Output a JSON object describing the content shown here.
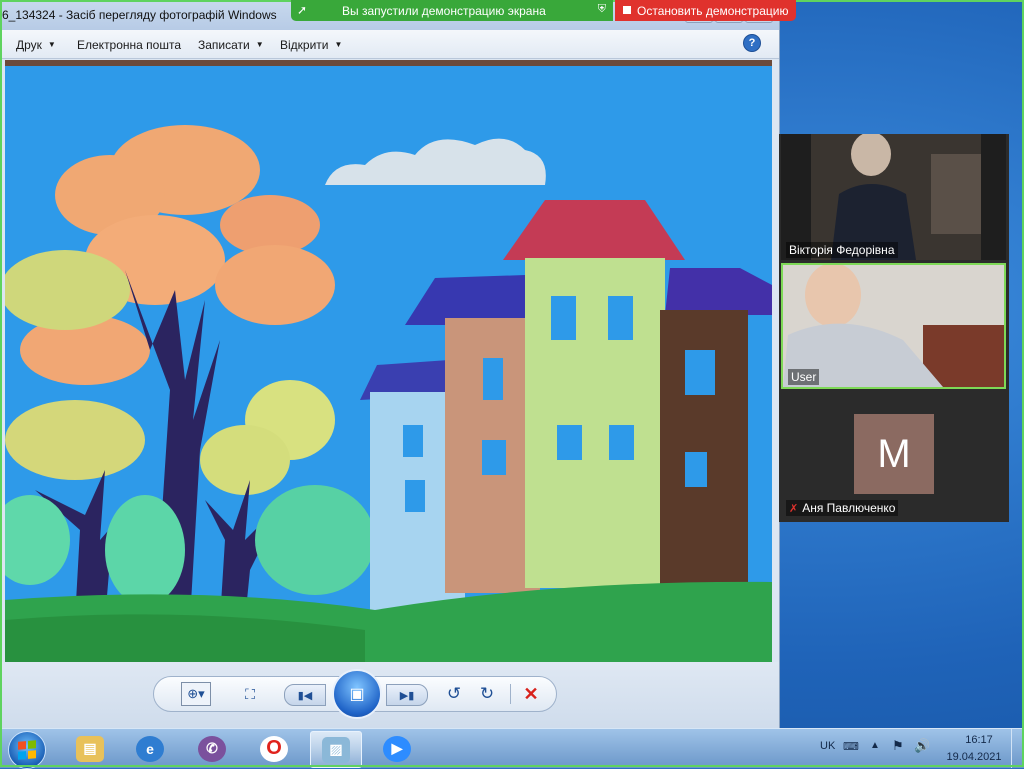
{
  "window": {
    "title": "6_134324 - Засіб перегляду фотографій Windows"
  },
  "menu": [
    {
      "label": "Друк",
      "has_dropdown": true
    },
    {
      "label": "Електронна пошта",
      "has_dropdown": false
    },
    {
      "label": "Записати",
      "has_dropdown": true
    },
    {
      "label": "Відкрити",
      "has_dropdown": true
    }
  ],
  "share_banner": {
    "message": "Вы запустили демонстрацию экрана",
    "stop_label": "Остановить демонстрацию",
    "border_color": "#5fd35f"
  },
  "participants": [
    {
      "name": "Вікторія Федорівна",
      "type": "video"
    },
    {
      "name": "User",
      "type": "video",
      "active_speaker": true
    },
    {
      "name": "Аня Павлюченко",
      "type": "avatar",
      "avatar_letter": "M",
      "muted": true,
      "avatar_color": "#8b6a61"
    }
  ],
  "viewer_controls": [
    "zoom",
    "fit-to-window",
    "previous",
    "slideshow",
    "next",
    "rotate-left",
    "rotate-right",
    "delete"
  ],
  "taskbar": {
    "apps": [
      "file-explorer",
      "browser",
      "viber",
      "opera",
      "photo-viewer",
      "zoom"
    ],
    "active_app": "photo-viewer"
  },
  "tray": {
    "language": "UK",
    "time": "16:17",
    "date": "19.04.2021"
  }
}
